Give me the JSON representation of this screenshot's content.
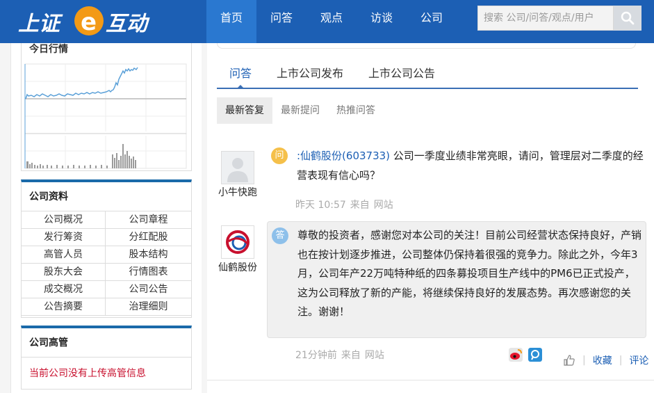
{
  "header": {
    "logo_text": "上证e互动",
    "nav": [
      "首页",
      "问答",
      "观点",
      "访谈",
      "公司"
    ],
    "search_placeholder": "搜索 公司/问答/观点/用户"
  },
  "left": {
    "chart_title": "今日行情",
    "company_info_title": "公司资料",
    "company_info_items": [
      "公司概况",
      "公司章程",
      "发行筹资",
      "分红配股",
      "高管人员",
      "股本结构",
      "股东大会",
      "行情图表",
      "成交概况",
      "公司公告",
      "公告摘要",
      "治理细则"
    ],
    "executives_title": "公司高管",
    "executives_empty": "当前公司没有上传高管信息"
  },
  "main": {
    "tabs": [
      "问答",
      "上市公司发布",
      "上市公司公告"
    ],
    "subtabs": [
      "最新答复",
      "最新提问",
      "热推问答"
    ],
    "question": {
      "badge": "问",
      "user_name": "小牛快跑",
      "company_link": ":仙鹤股份(603733)",
      "text": " 公司一季度业绩非常亮眼，请问，管理层对二季度的经营表现有信心吗？",
      "time": "昨天 10:57",
      "source_prefix": "来自",
      "source": "网站"
    },
    "answer": {
      "badge": "答",
      "company_name": "仙鹤股份",
      "text": "尊敬的投资者，感谢您对本公司的关注！目前公司经营状态保持良好，产销也在按计划逐步推进，公司整体仍保持着很强的竞争力。除此之外，今年3月，公司年产22万吨特种纸的四条募投项目生产线中的PM6已正式投产，这为公司释放了新的产能，将继续保持良好的发展态势。再次感谢您的关注。谢谢！",
      "time": "21分钟前",
      "source_prefix": "来自",
      "source": "网站"
    },
    "actions": {
      "favorite": "收藏",
      "comment": "评论"
    }
  },
  "colors": {
    "header_bg": "#1c5fb4",
    "accent": "#1c5fb4",
    "question_badge": "#f5c04a",
    "answer_badge": "#8ec0ea",
    "alert": "#c8102e"
  }
}
